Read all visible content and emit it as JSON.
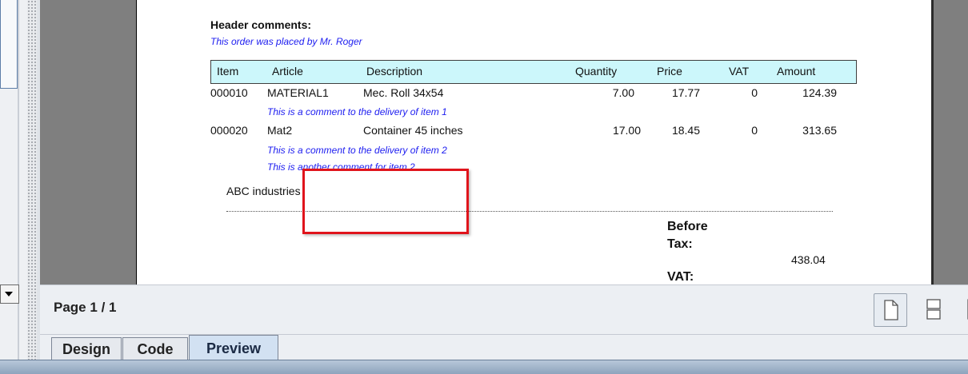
{
  "report": {
    "header_comments_label": "Header comments:",
    "header_comment": "This order was placed by Mr. Roger",
    "columns": [
      "Item",
      "Article",
      "Description",
      "Quantity",
      "Price",
      "VAT",
      "Amount"
    ],
    "rows": [
      {
        "item": "000010",
        "article": "MATERIAL1",
        "description": "Mec. Roll 34x54",
        "quantity": "7.00",
        "price": "17.77",
        "vat": "0",
        "amount": "124.39",
        "comments": [
          "This is a comment to the delivery of item 1"
        ]
      },
      {
        "item": "000020",
        "article": "Mat2",
        "description": "Container 45 inches",
        "quantity": "17.00",
        "price": "18.45",
        "vat": "0",
        "amount": "313.65",
        "comments": [
          "This is a comment to the delivery of item 2",
          "This is another comment for item 2"
        ]
      }
    ],
    "company": "ABC industries",
    "before_tax_label": "Before Tax:",
    "before_tax_value": "438.04",
    "vat_label": "VAT:"
  },
  "status": {
    "page_label": "Page",
    "current_page": "1",
    "separator": "/",
    "total_pages": "1"
  },
  "tabs": [
    "Design",
    "Code",
    "Preview"
  ],
  "active_tab": "Preview",
  "icons": {
    "single_page": "single-page-icon",
    "continuous": "continuous-pages-icon",
    "facing": "facing-pages-icon",
    "dropdown": "chevron-down-icon"
  },
  "colors": {
    "comment": "#1c1cf0",
    "table_header_bg": "#ccf7fb",
    "highlight": "#e0141c"
  }
}
